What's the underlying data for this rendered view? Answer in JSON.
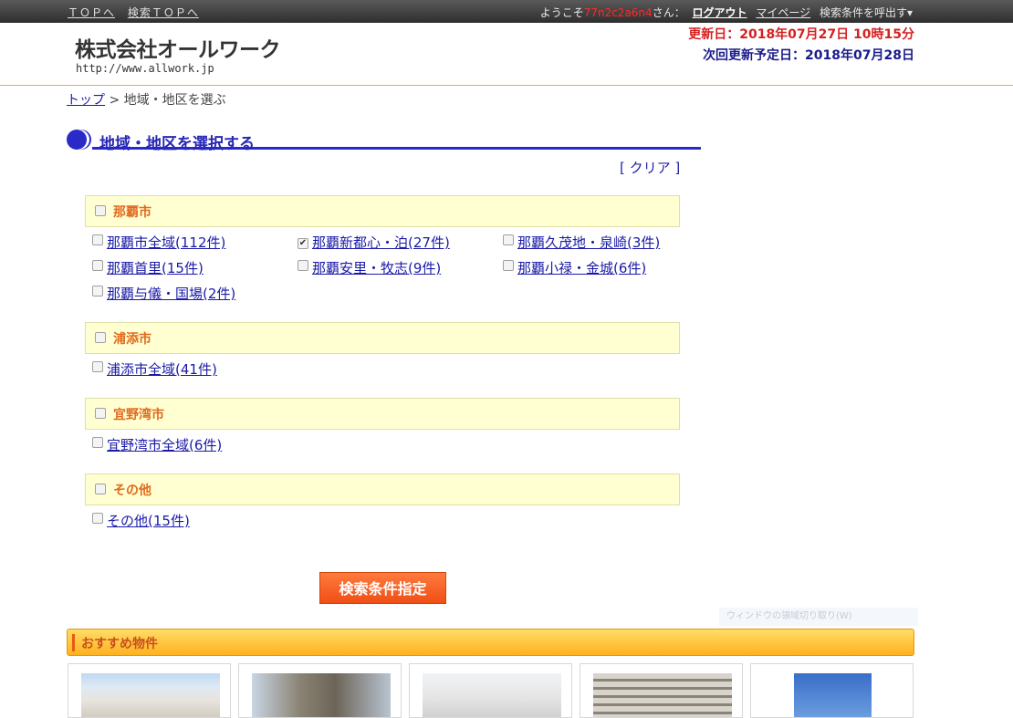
{
  "topbar": {
    "top_link": "ＴＯＰへ",
    "search_top_link": "検索ＴＯＰへ",
    "welcome_prefix": "ようこそ",
    "user_id": "77n2c2a6n4",
    "welcome_suffix": "さん：",
    "logout": "ログアウト",
    "mypage": "マイページ",
    "recall": "検索条件を呼出す▾"
  },
  "header": {
    "company": "株式会社オールワーク",
    "url": "http://www.allwork.jp",
    "updated": "更新日：2018年07月27日 10時15分",
    "next_update": "次回更新予定日：2018年07月28日"
  },
  "breadcrumb": {
    "home": "トップ",
    "sep": " > ",
    "current": "地域・地区を選ぶ"
  },
  "section": {
    "title": "地域・地区を選択する",
    "clear": "[ クリア ]"
  },
  "groups": [
    {
      "title": "那覇市",
      "checked": false,
      "items": [
        {
          "label": "那覇市全域(112件)",
          "checked": false
        },
        {
          "label": "那覇新都心・泊(27件)",
          "checked": true
        },
        {
          "label": "那覇久茂地・泉崎(3件)",
          "checked": false
        },
        {
          "label": "那覇首里(15件)",
          "checked": false
        },
        {
          "label": "那覇安里・牧志(9件)",
          "checked": false
        },
        {
          "label": "那覇小禄・金城(6件)",
          "checked": false
        },
        {
          "label": "那覇与儀・国場(2件)",
          "checked": false
        }
      ]
    },
    {
      "title": "浦添市",
      "checked": false,
      "items": [
        {
          "label": "浦添市全域(41件)",
          "checked": false
        }
      ]
    },
    {
      "title": "宜野湾市",
      "checked": false,
      "items": [
        {
          "label": "宜野湾市全域(6件)",
          "checked": false
        }
      ]
    },
    {
      "title": "その他",
      "checked": false,
      "items": [
        {
          "label": "その他(15件)",
          "checked": false
        }
      ]
    }
  ],
  "search_button": "検索条件指定",
  "ghost_text": "ウィンドウの領域切り取り(W)",
  "recommended": {
    "title": "おすすめ物件"
  },
  "colors": {
    "accent": "#f04f16",
    "heading_blue": "#2626b8",
    "group_bg": "#ffffd2",
    "group_title": "#e06a1e"
  }
}
